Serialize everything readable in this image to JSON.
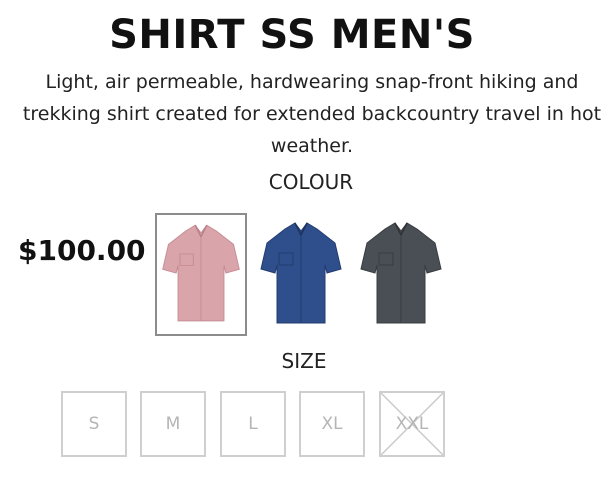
{
  "product": {
    "title": "SHIRT SS MEN'S",
    "description": "Light, air permeable, hardwearing snap-front hiking and trekking shirt created for extended backcountry travel in hot weather.",
    "price": "$100.00"
  },
  "colour": {
    "label": "COLOUR",
    "swatches": [
      {
        "name": "pink",
        "color": "#d9a5ab",
        "selected": true
      },
      {
        "name": "blue",
        "color": "#2e4e8c",
        "selected": false
      },
      {
        "name": "charcoal",
        "color": "#4a4f55",
        "selected": false
      }
    ]
  },
  "size": {
    "label": "SIZE",
    "options": [
      {
        "label": "S",
        "available": true
      },
      {
        "label": "M",
        "available": true
      },
      {
        "label": "L",
        "available": true
      },
      {
        "label": "XL",
        "available": true
      },
      {
        "label": "XXL",
        "available": false
      }
    ]
  },
  "colors": {
    "border_selected": "#8c8c8c",
    "border_size": "#cfcfcf",
    "size_text": "#b5b5b5",
    "cross_out": "#c8c8c8"
  }
}
